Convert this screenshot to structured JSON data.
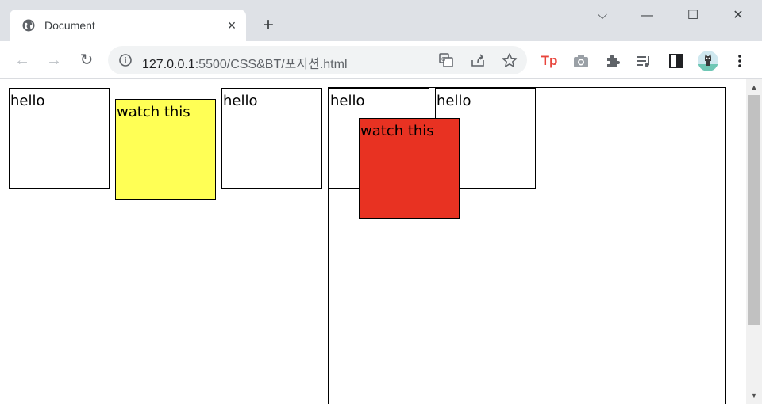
{
  "browser": {
    "tab_title": "Document",
    "tab_close": "×",
    "new_tab": "+",
    "url_host": "127.0.0.1",
    "url_rest": ":5500/CSS&BT/포지션.html",
    "window_controls": {
      "dropdown": "⌵",
      "minimize": "—",
      "maximize": "☐",
      "close": "✕"
    },
    "nav": {
      "back": "←",
      "forward": "→",
      "reload": "↻"
    },
    "icons": [
      "globe-icon",
      "info-icon",
      "translate-icon",
      "share-icon",
      "star-icon",
      "tp-extension-icon",
      "camera-icon",
      "puzzle-icon",
      "media-queue-icon",
      "sidepanel-icon",
      "avatar",
      "kebab-menu-icon"
    ]
  },
  "page": {
    "boxes": [
      {
        "text": "hello",
        "style": "plain"
      },
      {
        "text": "watch this",
        "style": "yellow"
      },
      {
        "text": "hello",
        "style": "plain"
      }
    ],
    "container_boxes": [
      {
        "text": "hello",
        "style": "plain"
      },
      {
        "text": "watch this",
        "style": "red"
      },
      {
        "text": "hello",
        "style": "plain"
      }
    ]
  },
  "colors": {
    "yellow": "#ffff55",
    "red": "#e83222",
    "tabstrip": "#dee1e6"
  }
}
